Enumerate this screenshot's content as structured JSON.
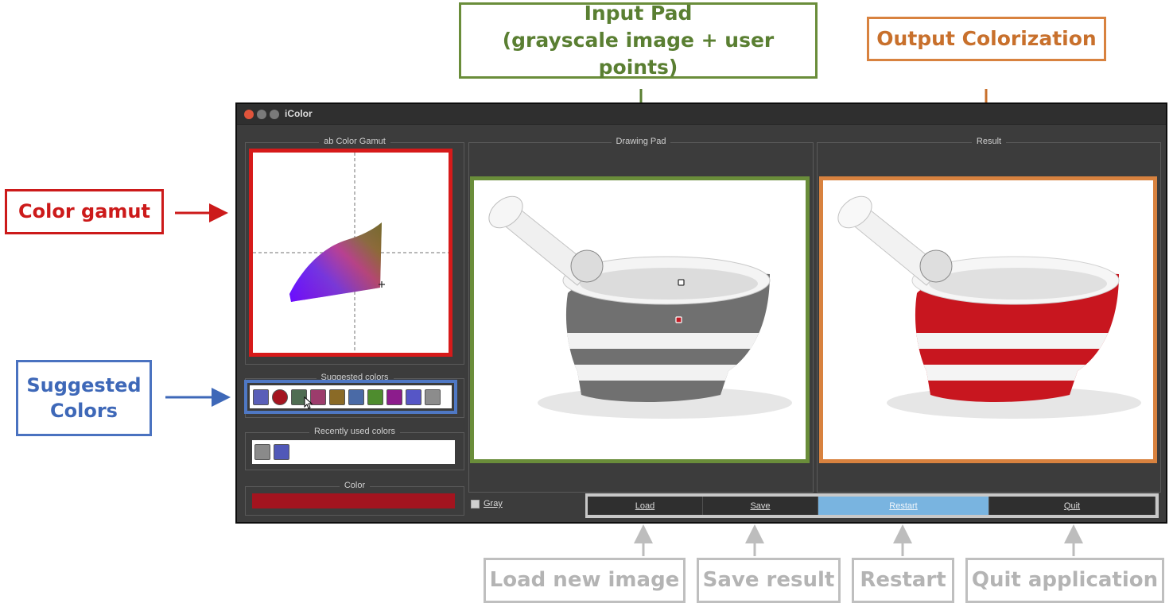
{
  "window": {
    "title": "iColor"
  },
  "callouts": {
    "input_pad_line1": "Input Pad",
    "input_pad_line2": "(grayscale image + user points)",
    "output": "Output Colorization",
    "gamut": "Color gamut",
    "suggested_line1": "Suggested",
    "suggested_line2": "Colors",
    "load": "Load new image",
    "save": "Save result",
    "restart": "Restart",
    "quit": "Quit application"
  },
  "panels": {
    "gamut_title": "ab Color Gamut",
    "suggested_title": "Suggested colors",
    "recent_title": "Recently used colors",
    "color_title": "Color",
    "drawing_title": "Drawing Pad",
    "result_title": "Result"
  },
  "suggested_colors": [
    "#5a5fb8",
    "#a51420",
    "#4f6d52",
    "#9c3c6c",
    "#8a6a26",
    "#4a6aa6",
    "#4e8c2e",
    "#8c1c8c",
    "#5656c6",
    "#8c8c8c"
  ],
  "recent_colors": [
    "#8a8a8a",
    "#5058b8"
  ],
  "current_color": "#a3141f",
  "gray_checkbox": {
    "label": "Gray",
    "checked": true
  },
  "buttons": {
    "load": "Load",
    "save": "Save",
    "restart": "Restart",
    "quit": "Quit"
  },
  "colors": {
    "accent_input": "#6a8d3a",
    "accent_output": "#d8823f",
    "accent_gamut": "#d61a1a",
    "accent_suggested": "#4f78c4",
    "button_active": "#79b4e0"
  }
}
